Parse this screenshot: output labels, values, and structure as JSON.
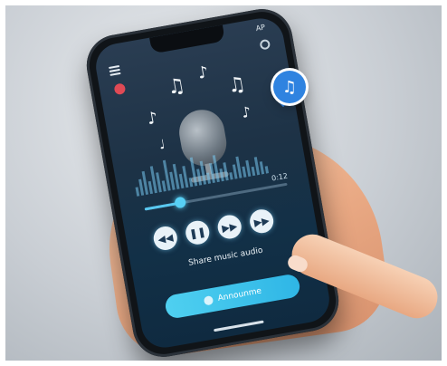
{
  "status": {
    "carrier": "AP"
  },
  "player": {
    "time": "0:12",
    "progress": 0.25,
    "controls": [
      "rewind",
      "pause",
      "forward",
      "skip"
    ],
    "share_label": "Share music audio",
    "button_label": "Announme"
  },
  "colors": {
    "accent": "#58c8f0",
    "badge": "#2f83e0",
    "record": "#e04a55"
  },
  "icons": [
    "menu-icon",
    "record-icon",
    "settings-icon",
    "music-note-icon",
    "microphone-icon"
  ]
}
